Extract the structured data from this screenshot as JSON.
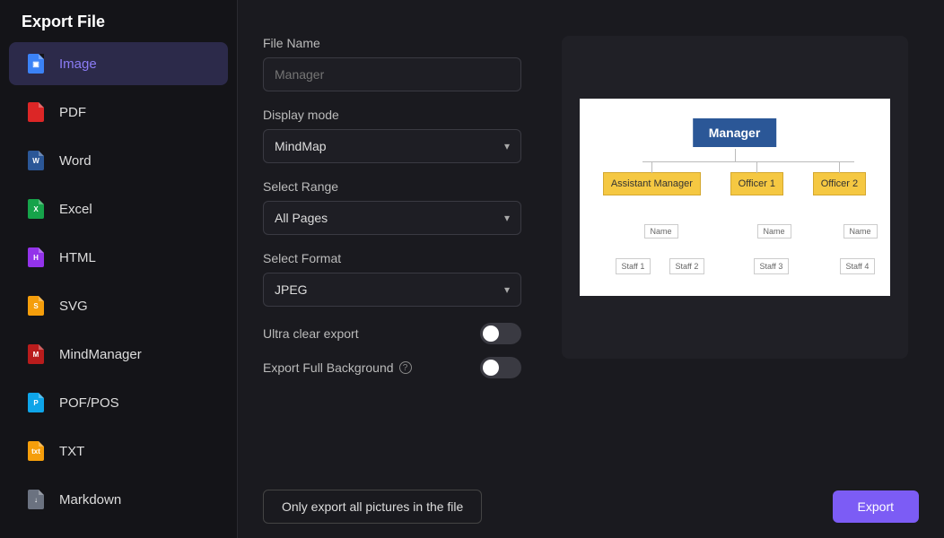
{
  "sidebar": {
    "title": "Export File",
    "items": [
      {
        "label": "Image",
        "icon": "image-icon",
        "color": "fi-blue",
        "active": true
      },
      {
        "label": "PDF",
        "icon": "pdf-icon",
        "color": "fi-red",
        "active": false
      },
      {
        "label": "Word",
        "icon": "word-icon",
        "color": "fi-darkblue",
        "active": false
      },
      {
        "label": "Excel",
        "icon": "excel-icon",
        "color": "fi-green",
        "active": false
      },
      {
        "label": "HTML",
        "icon": "html-icon",
        "color": "fi-purple",
        "active": false
      },
      {
        "label": "SVG",
        "icon": "svg-icon",
        "color": "fi-yellow",
        "active": false
      },
      {
        "label": "MindManager",
        "icon": "mindmanager-icon",
        "color": "fi-darkred",
        "active": false
      },
      {
        "label": "POF/POS",
        "icon": "pof-icon",
        "color": "fi-cyan",
        "active": false
      },
      {
        "label": "TXT",
        "icon": "txt-icon",
        "color": "fi-yellow",
        "active": false
      },
      {
        "label": "Markdown",
        "icon": "markdown-icon",
        "color": "fi-grey",
        "active": false
      }
    ]
  },
  "form": {
    "file_name_label": "File Name",
    "file_name_placeholder": "Manager",
    "display_mode_label": "Display mode",
    "display_mode_value": "MindMap",
    "select_range_label": "Select Range",
    "select_range_value": "All Pages",
    "select_format_label": "Select Format",
    "select_format_value": "JPEG",
    "ultra_clear_label": "Ultra clear export",
    "ultra_clear_value": false,
    "export_bg_label": "Export Full Background",
    "export_bg_value": false
  },
  "preview": {
    "root": "Manager",
    "level2": [
      "Assistant Manager",
      "Officer 1",
      "Officer 2"
    ],
    "name_label": "Name",
    "staff": [
      "Staff 1",
      "Staff 2",
      "Staff 3",
      "Staff 4"
    ]
  },
  "buttons": {
    "only_export": "Only export all pictures in the file",
    "export": "Export"
  }
}
